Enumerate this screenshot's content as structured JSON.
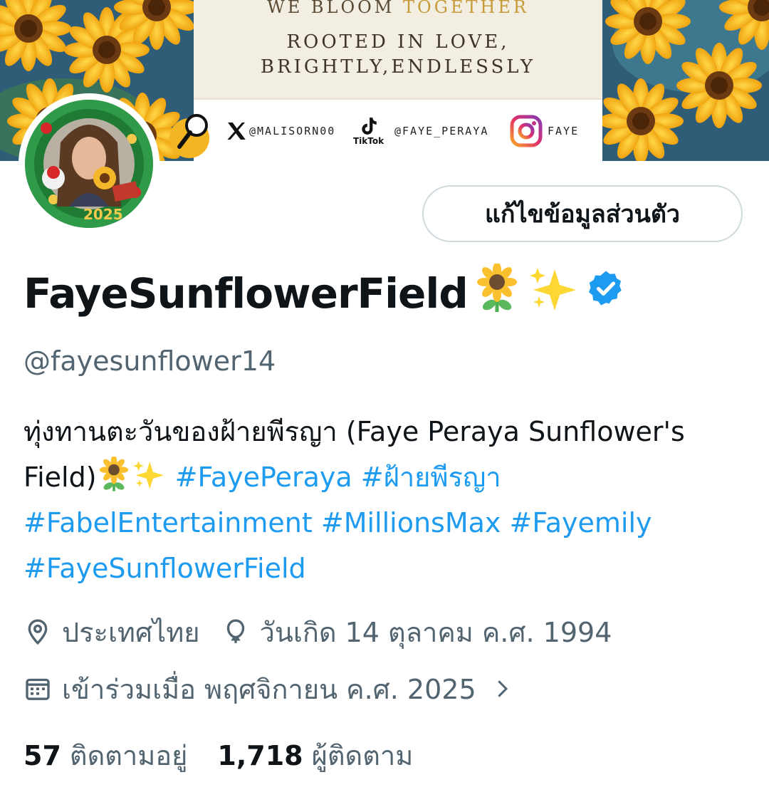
{
  "banner": {
    "line1_a": "WE BLOOM ",
    "line1_b": "TOGETHER",
    "line2": "ROOTED IN LOVE,",
    "line3": "BRIGHTLY,ENDLESSLY",
    "x_handle": "@MALISORN00",
    "tiktok_label": "TikTok",
    "tiktok_handle": "@FAYE_PERAYA",
    "ig_handle": "FAYE",
    "avatar_year": "2025"
  },
  "profile": {
    "edit_button": "แก้ไขข้อมูลส่วนตัว",
    "display_name": "FayeSunflowerField",
    "handle": "@fayesunflower14",
    "bio_text_1": "ทุ่งทานตะวันของฝ้ายพีรญา (Faye Peraya Sunflower's Field)",
    "hashtags": [
      "#FayePeraya",
      "#ฝ้ายพีรญา",
      "#FabelEntertainment",
      "#MillionsMax",
      "#Fayemily",
      "#FayeSunflowerField"
    ],
    "location": "ประเทศไทย",
    "birthday": "วันเกิด 14 ตุลาคม ค.ศ. 1994",
    "joined": "เข้าร่วมเมื่อ พฤศจิกายน ค.ศ. 2025",
    "following_count": "57",
    "following_label": "ติดตามอยู่",
    "followers_count": "1,718",
    "followers_label": "ผู้ติดตาม"
  },
  "icons": [
    "search-icon",
    "x-logo-icon",
    "tiktok-icon",
    "instagram-icon",
    "sunflower-emoji",
    "sparkles-emoji",
    "verified-badge-icon",
    "location-pin-icon",
    "balloon-icon",
    "calendar-icon",
    "chevron-right-icon"
  ],
  "colors": {
    "link": "#1d9bf0",
    "secondary_text": "#536471",
    "verified": "#1d9bf0"
  }
}
